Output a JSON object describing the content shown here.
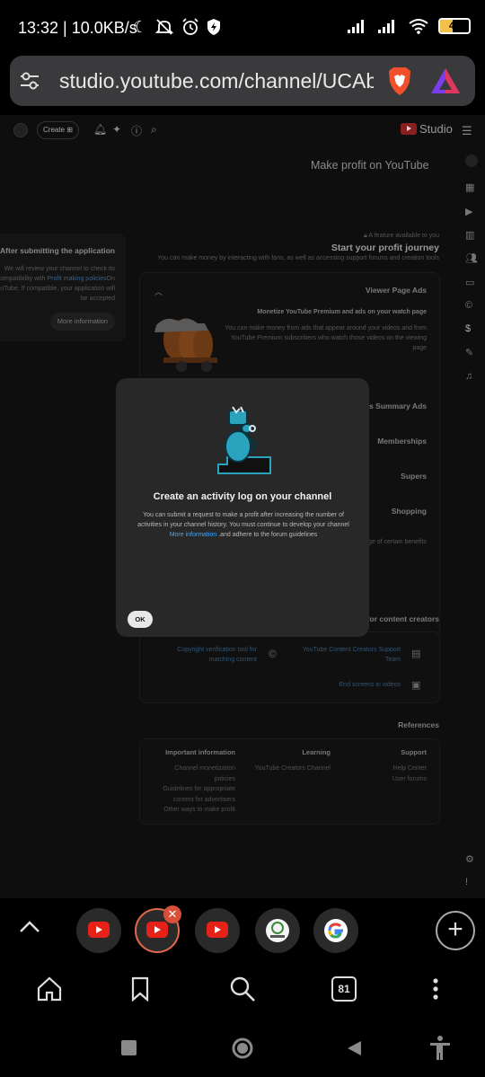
{
  "status_bar": {
    "time": "13:32",
    "speed": "10.0KB/s",
    "battery": "43",
    "battery_level": 0.43
  },
  "browser": {
    "url": "studio.youtube.com/channel/UCAbc",
    "tab_count": "81",
    "accent_color": "#e36a4c"
  },
  "studio": {
    "create_label": "Create",
    "logo_text": "Studio",
    "page_title": "Make profit on YouTube",
    "left_card": {
      "title": "After submitting the application",
      "body_prefix": "We will review your channel to check its compatibility with ",
      "body_link": "Profit making policies",
      "body_suffix": "On YouTube. If compatible, your application will be accepted",
      "button": "More information"
    },
    "feature_note": "A feature available to you",
    "journey_title": "Start your profit journey",
    "journey_sub": "You can make money by interacting with fans, as well as accessing support forums and creation tools",
    "viewer_page_ads": "Viewer Page Ads",
    "monetize_title": "Monetize YouTube Premium and ads on your watch page",
    "monetize_body": "You can make money from ads that appear around your videos and from YouTube Premium subscribers who watch those videos on the viewing page",
    "shorts_summary_ads": "rts Summary Ads",
    "memberships": "Memberships",
    "supers": "Supers",
    "shopping": "Shopping",
    "benefits_fragment": "ntage of certain benefits",
    "tools_for_creators": "s for content creators",
    "tool_copyright": "Copyright verification tool for matching content",
    "tool_support": "YouTube Content Creators Support Team",
    "tool_end_screens": "End screens in videos",
    "references": "References",
    "ref_important": "Important information",
    "ref_important_items": [
      "Channel monetization policies",
      "Guidelines for appropriate content for advertisers",
      "Other ways to make profit"
    ],
    "ref_learning": "Learning",
    "ref_learning_items": [
      "YouTube Creators Channel"
    ],
    "ref_support": "Support",
    "ref_support_items": [
      "Help Center",
      "User forums"
    ]
  },
  "modal": {
    "title": "Create an activity log on your channel",
    "body": "You can submit a request to make a profit after increasing the number of activities in your channel history. You must continue to develop your channel",
    "more_link": "More information",
    "body_suffix": " .and adhere to the forum guidelines",
    "ok": "OK"
  },
  "tabs": [
    {
      "icon": "youtube-icon"
    },
    {
      "icon": "youtube-icon",
      "active": true
    },
    {
      "icon": "youtube-icon"
    },
    {
      "icon": "site-logo-icon"
    },
    {
      "icon": "google-icon"
    }
  ]
}
